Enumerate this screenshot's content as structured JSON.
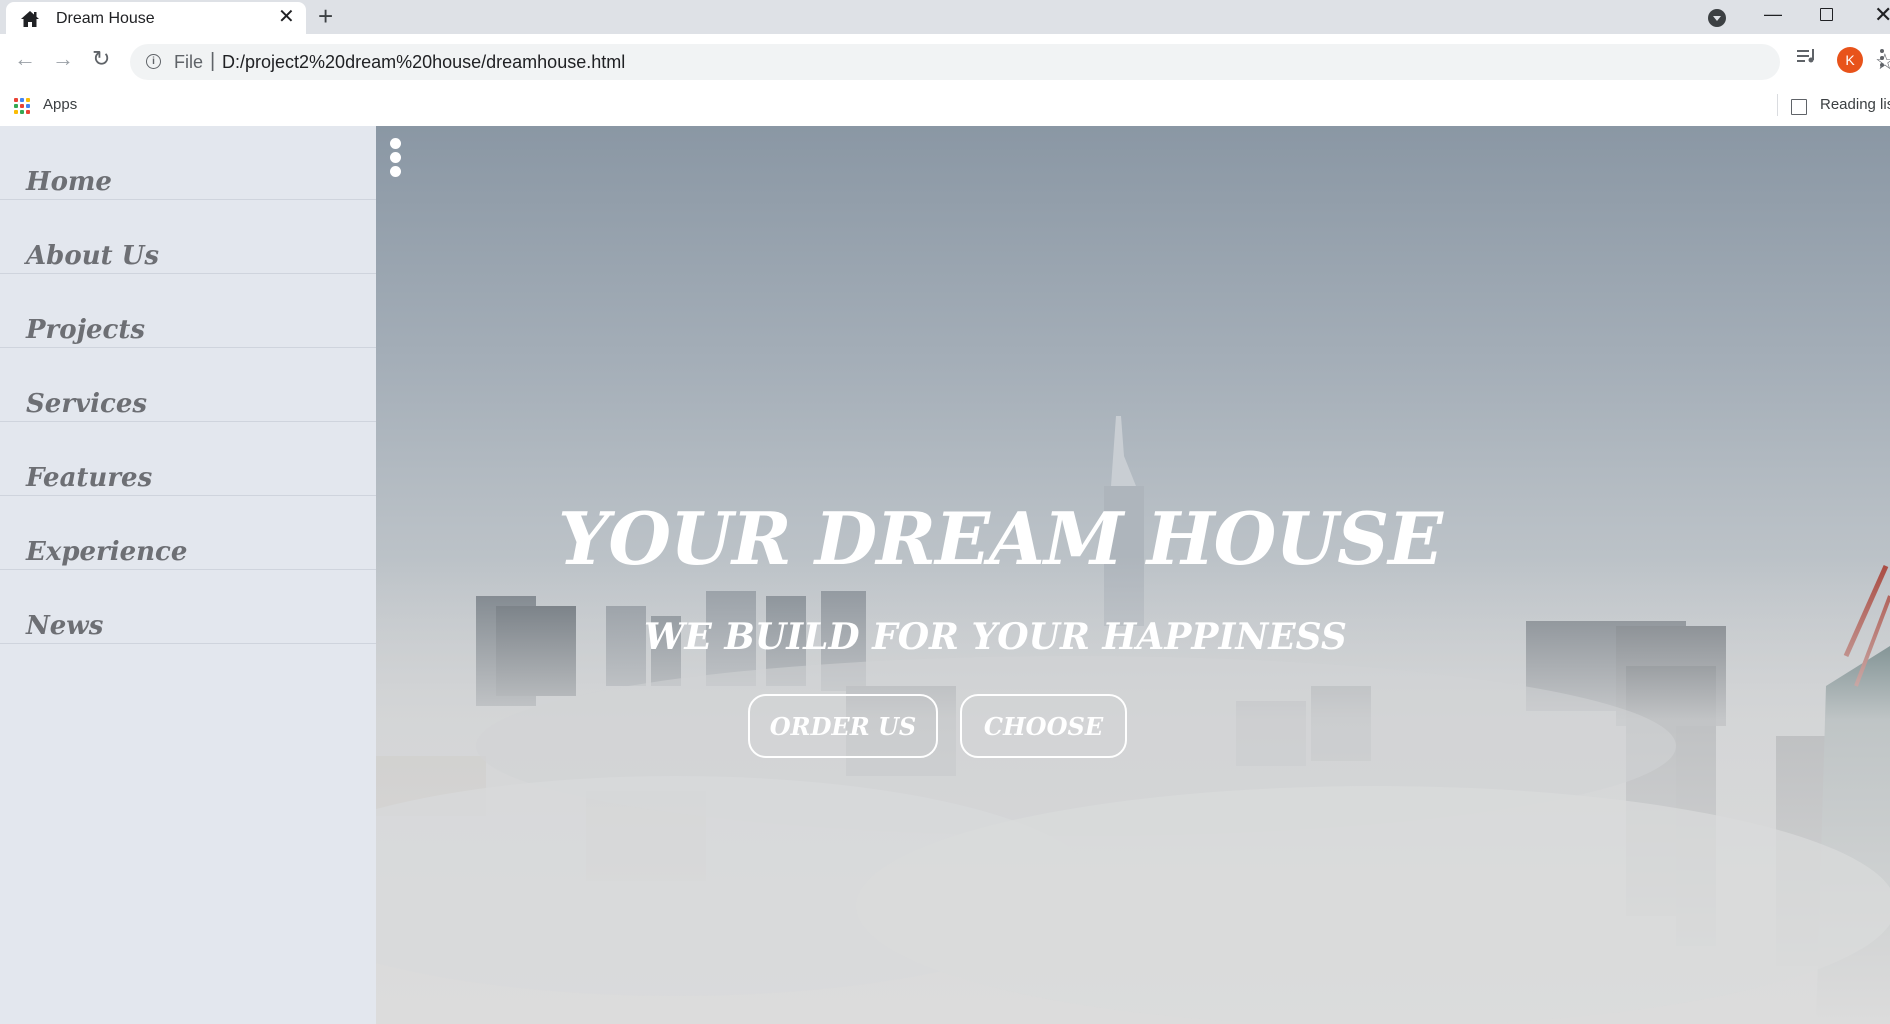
{
  "browser": {
    "tab_title": "Dream House",
    "new_tab_symbol": "+",
    "close_symbol": "✕",
    "omnibox_scheme_label": "File",
    "omnibox_separator": "|",
    "url": "D:/project2%20dream%20house/dreamhouse.html",
    "profile_initial": "K",
    "bookmarks": {
      "apps_label": "Apps",
      "reading_list_label": "Reading list"
    }
  },
  "sidebar": {
    "items": [
      {
        "label": "Home"
      },
      {
        "label": "About Us"
      },
      {
        "label": "Projects"
      },
      {
        "label": "Services"
      },
      {
        "label": "Features"
      },
      {
        "label": "Experience"
      },
      {
        "label": "News"
      }
    ]
  },
  "hero": {
    "title": "YOUR DREAM HOUSE",
    "subtitle": "WE BUILD FOR YOUR HAPPINESS",
    "buttons": {
      "order": "ORDER US",
      "choose": "CHOOSE"
    }
  },
  "colors": {
    "sidebar_bg": "#e3e7ee",
    "nav_text": "#6d6f74",
    "hero_text": "#ffffff",
    "avatar": "#e8531a"
  },
  "icons": [
    "home-icon",
    "close-icon",
    "plus-icon",
    "tab-search-icon",
    "back-icon",
    "forward-icon",
    "reload-icon",
    "info-icon",
    "star-icon",
    "media-control-icon",
    "menu-icon",
    "apps-icon",
    "reading-list-icon",
    "kebab-menu-icon"
  ]
}
